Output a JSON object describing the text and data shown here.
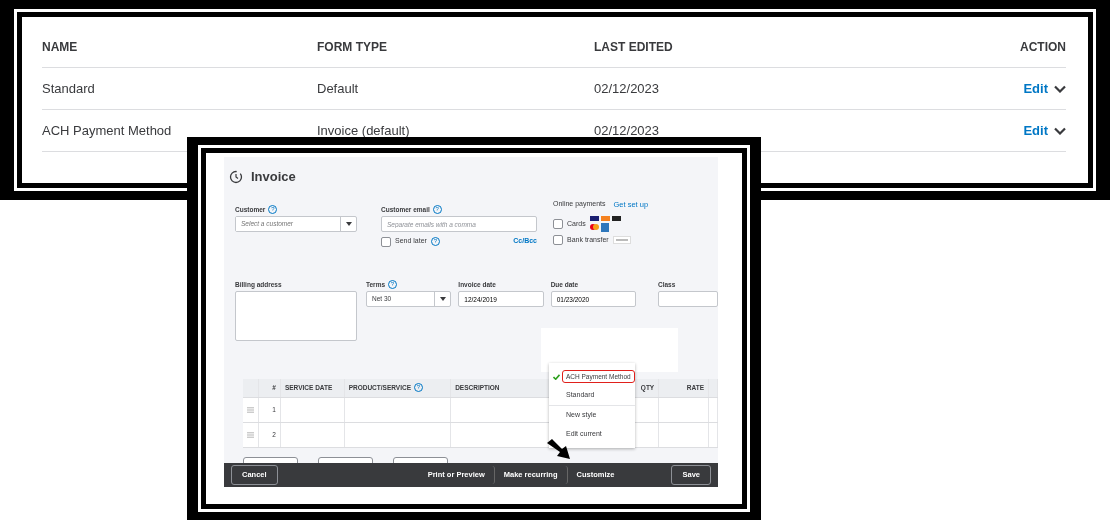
{
  "forms_table": {
    "columns": [
      "NAME",
      "FORM TYPE",
      "LAST EDITED",
      "ACTION"
    ],
    "rows": [
      {
        "name": "Standard",
        "form_type": "Default",
        "last_edited": "02/12/2023",
        "action": "Edit"
      },
      {
        "name": "ACH Payment Method",
        "form_type": "Invoice (default)",
        "last_edited": "02/12/2023",
        "action": "Edit"
      }
    ]
  },
  "invoice": {
    "title": "Invoice",
    "customer": {
      "label": "Customer",
      "help": "?",
      "placeholder": "Select a customer"
    },
    "customer_email": {
      "label": "Customer email",
      "help": "?",
      "placeholder": "Separate emails with a comma"
    },
    "send_later": {
      "label": "Send later",
      "help": "?",
      "checked": false
    },
    "cc_bcc": "Cc/Bcc",
    "online_payments": {
      "label": "Online payments",
      "link": "Get set up",
      "methods": [
        {
          "label": "Cards",
          "checked": false,
          "kind": "cards"
        },
        {
          "label": "Bank transfer",
          "checked": false,
          "kind": "bank"
        }
      ]
    },
    "billing_address": {
      "label": "Billing address"
    },
    "terms": {
      "label": "Terms",
      "help": "?",
      "value": "Net 30"
    },
    "invoice_date": {
      "label": "Invoice date",
      "value": "12/24/2019"
    },
    "due_date": {
      "label": "Due date",
      "value": "01/23/2020"
    },
    "class": {
      "label": "Class"
    },
    "line_table": {
      "columns": [
        "#",
        "SERVICE DATE",
        "PRODUCT/SERVICE",
        "DESCRIPTION",
        "QTY",
        "RATE"
      ],
      "product_help": "?",
      "rows": [
        {
          "number": "1"
        },
        {
          "number": "2"
        }
      ]
    },
    "style_menu": {
      "items": [
        {
          "label": "ACH Payment Method",
          "selected": true,
          "highlighted": true,
          "divider_above": false
        },
        {
          "label": "Standard",
          "selected": false,
          "highlighted": false,
          "divider_above": false
        },
        {
          "label": "New style",
          "selected": false,
          "highlighted": false,
          "divider_above": true
        },
        {
          "label": "Edit current",
          "selected": false,
          "highlighted": false,
          "divider_above": false
        }
      ]
    },
    "footer": {
      "cancel": "Cancel",
      "actions": [
        "Print or Preview",
        "Make recurring",
        "Customize"
      ],
      "save": "Save"
    }
  }
}
